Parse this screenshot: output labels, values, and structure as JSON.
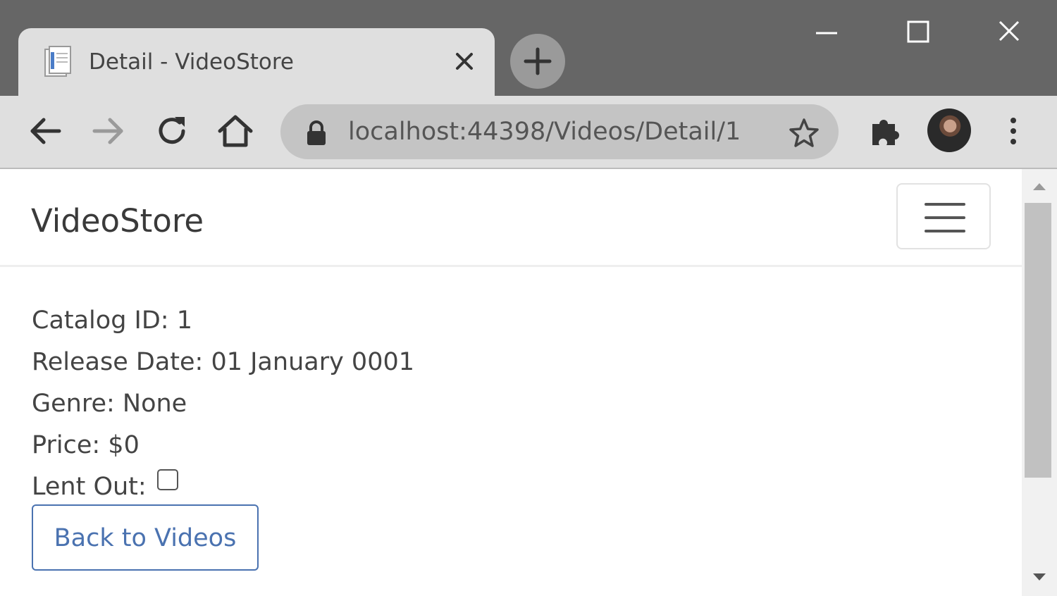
{
  "browser": {
    "tab": {
      "title": "Detail - VideoStore"
    },
    "address_bar": {
      "url": "localhost:44398/Videos/Detail/1"
    }
  },
  "navbar": {
    "brand": "VideoStore"
  },
  "details": {
    "catalog_id": "Catalog ID: 1",
    "release_date": "Release Date: 01 January 0001",
    "genre": "Genre: None",
    "price": "Price: $0",
    "lent_out_label": "Lent Out:",
    "lent_out_checked": false
  },
  "actions": {
    "back_label": "Back to Videos"
  },
  "icons": {
    "tab": "page-icon",
    "close": "close-icon",
    "new_tab": "plus-icon",
    "minimize": "minimize-icon",
    "maximize": "maximize-icon",
    "window_close": "window-close-icon",
    "back": "arrow-left-icon",
    "forward": "arrow-right-icon",
    "reload": "reload-icon",
    "home": "home-icon",
    "lock": "lock-icon",
    "bookmark": "star-icon",
    "extensions": "puzzle-icon",
    "profile": "avatar",
    "menu": "kebab-menu-icon",
    "navbar_toggle": "hamburger-icon"
  },
  "colors": {
    "frame": "#666666",
    "toolbar": "#dfdfdf",
    "link_button": "#4a72b0"
  }
}
